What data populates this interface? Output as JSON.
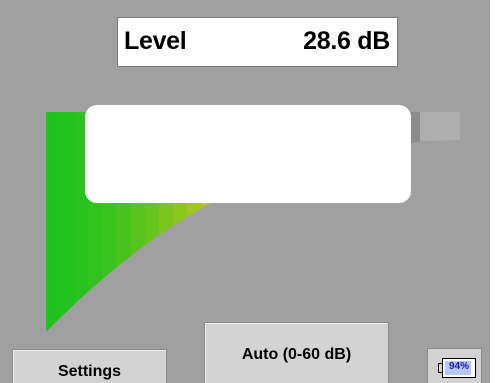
{
  "level": {
    "label": "Level",
    "value": "28.6 dB"
  },
  "meter": {
    "range_db": [
      0,
      60
    ],
    "level_db": 28.6,
    "colors": {
      "low": "#1ec31e",
      "high": "#e6c81e",
      "empty": "#8c8c8c",
      "tail": "#afafaf"
    }
  },
  "buttons": {
    "settings": "Settings",
    "range": "Auto (0-60 dB)"
  },
  "battery": {
    "text": "94%",
    "percent": 94
  },
  "colors": {
    "screen_bg": "#a0a0a0",
    "button_bg": "#d3d3d3",
    "battery_text": "#1b1bb4"
  }
}
